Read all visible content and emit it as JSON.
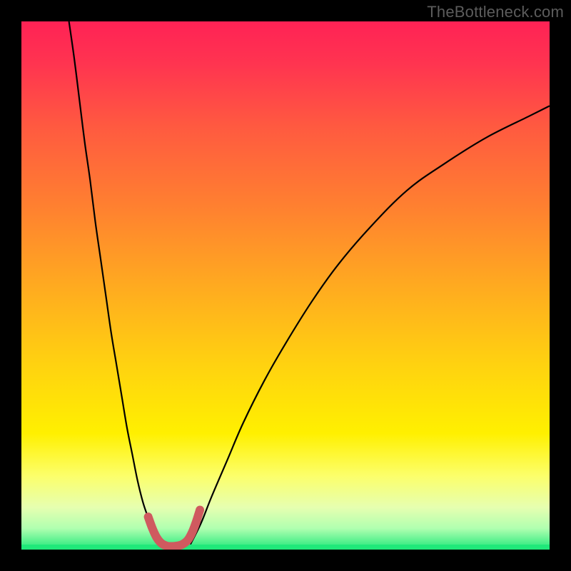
{
  "watermark": "TheBottleneck.com",
  "chart_data": {
    "type": "line",
    "title": "",
    "xlabel": "",
    "ylabel": "",
    "xlim": [
      0,
      100
    ],
    "ylim": [
      0,
      100
    ],
    "background_gradient": {
      "stops": [
        {
          "t": 0.0,
          "color": "#ff2255"
        },
        {
          "t": 0.08,
          "color": "#ff3450"
        },
        {
          "t": 0.2,
          "color": "#ff5a40"
        },
        {
          "t": 0.35,
          "color": "#ff8030"
        },
        {
          "t": 0.5,
          "color": "#ffaa20"
        },
        {
          "t": 0.65,
          "color": "#ffd210"
        },
        {
          "t": 0.78,
          "color": "#fff000"
        },
        {
          "t": 0.86,
          "color": "#fcff6a"
        },
        {
          "t": 0.92,
          "color": "#e6ffb0"
        },
        {
          "t": 0.96,
          "color": "#b0ffb0"
        },
        {
          "t": 1.0,
          "color": "#20e87a"
        }
      ]
    },
    "series": [
      {
        "name": "curve-left",
        "color": "#000000",
        "width": 2.2,
        "x": [
          9,
          10,
          11,
          12,
          13,
          14,
          15,
          16,
          17,
          18,
          19,
          20,
          21,
          22,
          23,
          24,
          25,
          26
        ],
        "y": [
          100,
          93,
          85,
          77,
          70,
          62,
          55,
          48,
          41,
          35,
          29,
          23,
          18,
          13,
          9,
          6,
          3,
          1
        ]
      },
      {
        "name": "curve-right",
        "color": "#000000",
        "width": 2.2,
        "x": [
          32,
          34,
          36,
          39,
          42,
          46,
          50,
          55,
          60,
          66,
          73,
          80,
          88,
          96,
          100
        ],
        "y": [
          1,
          5,
          10,
          17,
          24,
          32,
          39,
          47,
          54,
          61,
          68,
          73,
          78,
          82,
          84
        ]
      },
      {
        "name": "highlight-segment",
        "color": "#cf5a5f",
        "width": 12,
        "linecap": "round",
        "x": [
          24.0,
          24.8,
          25.6,
          26.5,
          27.5,
          28.5,
          29.5,
          30.5,
          31.5,
          32.3,
          33.0,
          33.8
        ],
        "y": [
          6.2,
          4.0,
          2.3,
          1.2,
          0.7,
          0.6,
          0.7,
          1.0,
          1.8,
          3.2,
          5.0,
          7.5
        ]
      }
    ],
    "baseline": {
      "color": "#20e87a",
      "y": 0,
      "thickness": 7
    }
  }
}
